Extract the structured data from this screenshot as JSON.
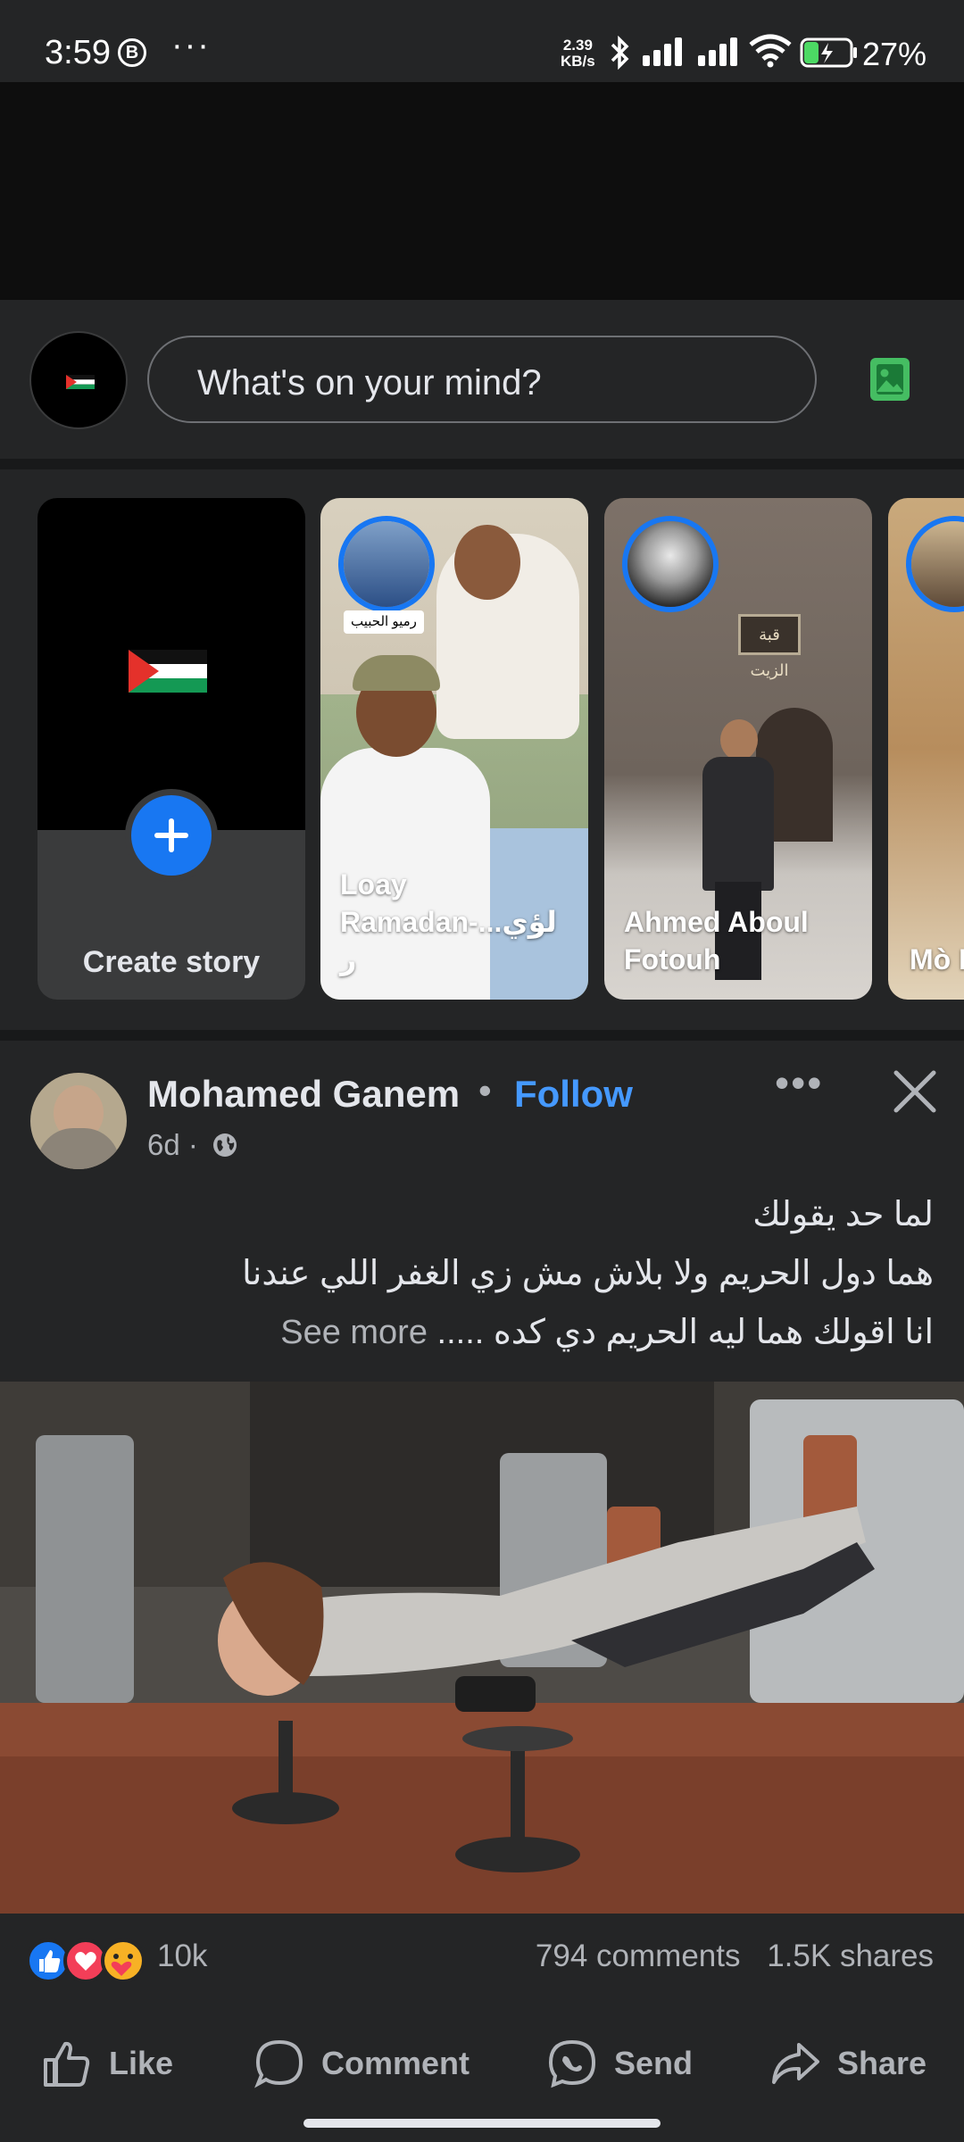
{
  "status_bar": {
    "time": "3:59",
    "b_badge": "B",
    "overflow": "···",
    "net_speed_value": "2.39",
    "net_speed_unit": "KB/s",
    "battery_percent": "27%",
    "battery_level": 0.27,
    "icons": [
      "bluetooth-icon",
      "signal-icon",
      "signal-icon",
      "wifi-icon",
      "battery-charging-icon"
    ]
  },
  "composer": {
    "placeholder": "What's on your mind?",
    "avatar_icon": "palestine-flag",
    "photo_icon": "photo-icon"
  },
  "stories": [
    {
      "label": "Create story",
      "type": "create",
      "icon": "plus-icon"
    },
    {
      "label": "Loay Ramadan-...لؤي ر",
      "overlay_text": "رميو الحبيب"
    },
    {
      "label": "Ahmed Aboul Fotouh",
      "sign_text": "قبة الزيت"
    },
    {
      "label": "Mò I"
    }
  ],
  "post": {
    "author": "Mohamed Ganem",
    "separator": "•",
    "follow_label": "Follow",
    "time": "6d ·",
    "privacy_icon": "globe-icon",
    "more_icon": "more-horizontal-icon",
    "close_icon": "close-icon",
    "text_lines": [
      "لما حد  يقولك",
      " هما دول الحريم ولا بلاش مش زي الغفر اللي عندنا",
      "انا اقولك هما ليه الحريم دي كده ..... "
    ],
    "see_more": "See more",
    "reactions": [
      "like-icon",
      "love-icon",
      "care-icon"
    ],
    "reaction_count": "10k",
    "comments": "794 comments",
    "shares": "1.5K shares",
    "actions": [
      {
        "label": "Like",
        "icon": "thumbs-up-icon"
      },
      {
        "label": "Comment",
        "icon": "comment-icon"
      },
      {
        "label": "Send",
        "icon": "messenger-icon"
      },
      {
        "label": "Share",
        "icon": "share-icon"
      }
    ]
  },
  "colors": {
    "background": "#242526",
    "separator": "#18191a",
    "accent_blue": "#1877f2",
    "follow_blue": "#4599ff",
    "photo_green": "#45bd62"
  }
}
